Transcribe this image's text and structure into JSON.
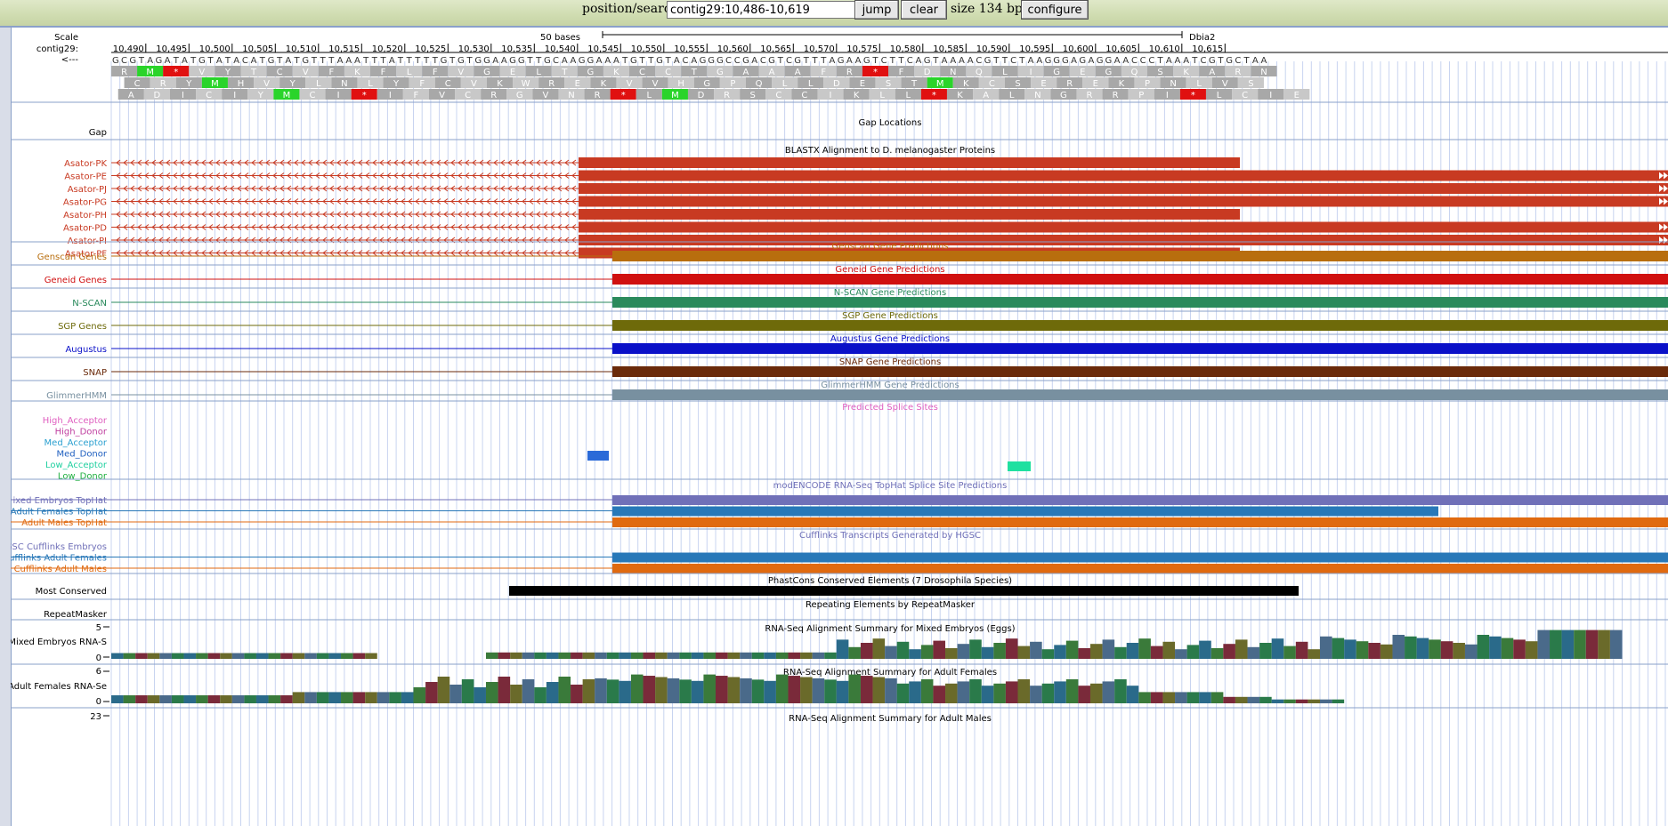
{
  "topbar": {
    "search_label": "position/search",
    "search_value": "contig29:10,486-10,619",
    "jump_label": "jump",
    "clear_label": "clear",
    "size_text": "size 134 bp.",
    "configure_label": "configure"
  },
  "ruler": {
    "scale_label": "Scale",
    "contig_label": "contig29:",
    "strand_label": "<---",
    "bases_label": "50 bases",
    "assembly_label": "Dbia2",
    "ticks": [
      "10,490",
      "10,495",
      "10,500",
      "10,505",
      "10,510",
      "10,515",
      "10,520",
      "10,525",
      "10,530",
      "10,535",
      "10,540",
      "10,545",
      "10,550",
      "10,555",
      "10,560",
      "10,565",
      "10,570",
      "10,575",
      "10,580",
      "10,585",
      "10,590",
      "10,595",
      "10,600",
      "10,605",
      "10,610",
      "10,615"
    ],
    "sequence": "GCGTAGATATGTATACATGTATGTTTAAATTTATTTTTGTGTGGAAGGTTGCAAGGAAATGTTGTACAGGGCCGACGTCGTTTAGAAGTCTTCAGTAAAACGTTCTAAGGGAGAGGAACCCTAAATCGTGCTAA",
    "frame1": [
      "R",
      "M",
      "*",
      "V",
      "Y",
      "T",
      "C",
      "V",
      "F",
      "K",
      "F",
      "L",
      "F",
      "V",
      "G",
      "E",
      "L",
      "T",
      "G",
      "K",
      "C",
      "C",
      "T",
      "G",
      "A",
      "A",
      "A",
      "F",
      "R",
      "*",
      "F",
      "D",
      "N",
      "Q",
      "L",
      "I",
      "G",
      "E",
      "G",
      "Q",
      "S",
      "K",
      "A",
      "R",
      "N"
    ],
    "frame2": [
      "C",
      "R",
      "Y",
      "M",
      "H",
      "V",
      "Y",
      "L",
      "N",
      "L",
      "Y",
      "F",
      "C",
      "V",
      "K",
      "W",
      "R",
      "E",
      "K",
      "V",
      "V",
      "H",
      "G",
      "P",
      "Q",
      "L",
      "L",
      "D",
      "E",
      "S",
      "T",
      "M",
      "K",
      "C",
      "S",
      "E",
      "R",
      "E",
      "K",
      "P",
      "N",
      "L",
      "V",
      "S"
    ],
    "frame3": [
      "A",
      "D",
      "I",
      "C",
      "I",
      "Y",
      "M",
      "C",
      "I",
      "*",
      "I",
      "F",
      "V",
      "C",
      "R",
      "G",
      "V",
      "N",
      "R",
      "*",
      "L",
      "M",
      "D",
      "R",
      "S",
      "C",
      "C",
      "I",
      "K",
      "L",
      "L",
      "*",
      "K",
      "A",
      "L",
      "N",
      "G",
      "R",
      "R",
      "P",
      "I",
      "*",
      "L",
      "C",
      "I",
      "E"
    ]
  },
  "tracks": {
    "gap": {
      "label": "Gap",
      "title": "Gap Locations"
    },
    "blastx": {
      "title": "BLASTX Alignment to D. melanogaster Proteins",
      "items": [
        "Asator-PK",
        "Asator-PE",
        "Asator-PJ",
        "Asator-PG",
        "Asator-PH",
        "Asator-PD",
        "Asator-PI",
        "Asator-PF"
      ]
    },
    "genscan": {
      "label": "Genscan Genes",
      "title": "Genscan Gene Predictions"
    },
    "geneid": {
      "label": "Geneid Genes",
      "title": "Geneid Gene Predictions"
    },
    "nscan": {
      "label": "N-SCAN",
      "title": "N-SCAN Gene Predictions"
    },
    "sgp": {
      "label": "SGP Genes",
      "title": "SGP Gene Predictions"
    },
    "augustus": {
      "label": "Augustus",
      "title": "Augustus Gene Predictions"
    },
    "snap": {
      "label": "SNAP",
      "title": "SNAP Gene Predictions"
    },
    "glimmer": {
      "label": "GlimmerHMM",
      "title": "GlimmerHMM Gene Predictions"
    },
    "splice": {
      "title": "Predicted Splice Sites",
      "items": [
        "High_Acceptor",
        "High_Donor",
        "Med_Acceptor",
        "Med_Donor",
        "Low_Acceptor",
        "Low_Donor"
      ]
    },
    "tophat": {
      "title": "modENCODE RNA-Seq TopHat Splice Site Predictions",
      "items": [
        "ixed Embryos TopHat",
        "Adult Females TopHat",
        "Adult Males TopHat"
      ]
    },
    "cufflinks": {
      "title": "Cufflinks Transcripts Generated by HGSC",
      "items": [
        "GSC Cufflinks Embryos",
        "ufflinks Adult Females",
        "Cufflinks Adult Males"
      ]
    },
    "phastcons": {
      "label": "Most Conserved",
      "title": "PhastCons Conserved Elements (7 Drosophila Species)"
    },
    "repeatmasker": {
      "label": "RepeatMasker",
      "title": "Repeating Elements by RepeatMasker"
    },
    "rnaseq_embryo": {
      "label": "Mixed Embryos RNA-S",
      "title": "RNA-Seq Alignment Summary for Mixed Embryos (Eggs)",
      "ymax": "5",
      "ymin": "0"
    },
    "rnaseq_female": {
      "label": "Adult Females RNA-Se",
      "title": "RNA-Seq Alignment Summary for Adult Females",
      "ymax": "6",
      "ymin": "0"
    },
    "rnaseq_male": {
      "title": "RNA-Seq Alignment Summary for Adult Males",
      "ymax": "23"
    }
  },
  "colors": {
    "blastx": "#c83a22",
    "genscan": "#b86e0e",
    "geneid": "#d01010",
    "nscan": "#2a8a5c",
    "sgp": "#6e6a0a",
    "augustus": "#0a10c8",
    "snap": "#6a2a0a",
    "glimmer": "#7890a0",
    "tophat_embryo": "#7070b8",
    "tophat_female": "#2878b8",
    "tophat_male": "#e06a10"
  }
}
